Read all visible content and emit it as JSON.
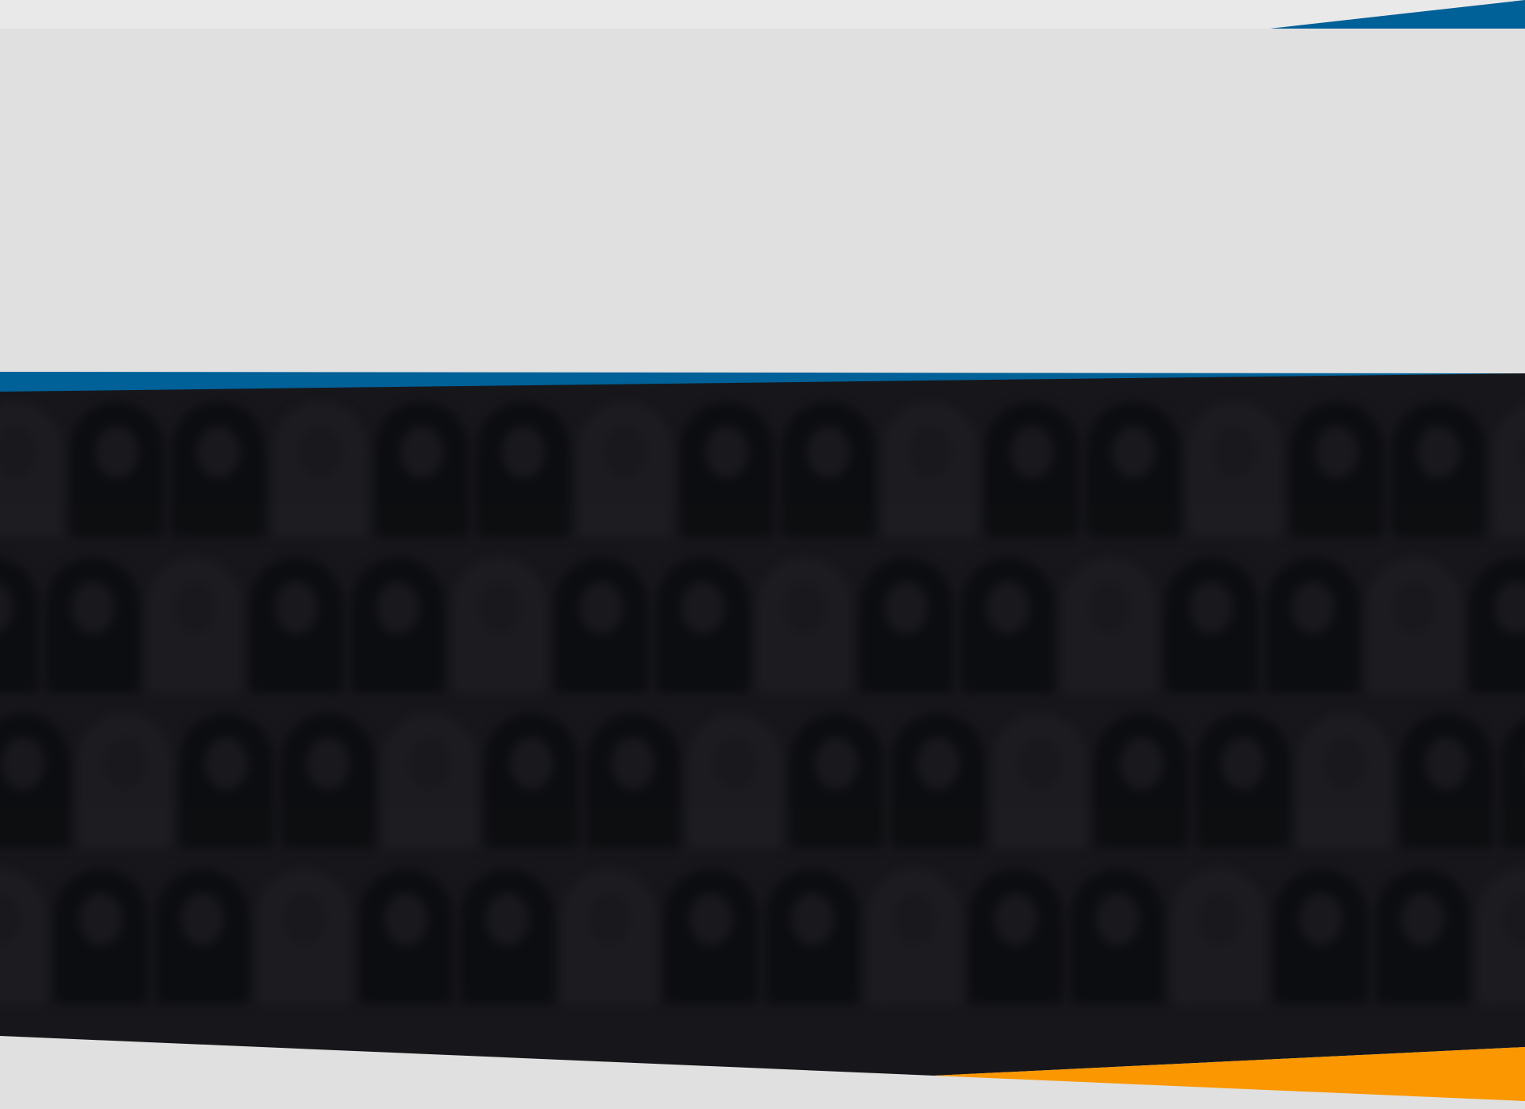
{
  "colors": {
    "background": "#e0e0e0",
    "top_strip": "#e9e9e9",
    "brand_blue": "#006098",
    "mosaic_dark": "#17171b",
    "accent_orange": "#fb9700"
  },
  "hero": {
    "image": "blurred-portrait-mosaic"
  }
}
